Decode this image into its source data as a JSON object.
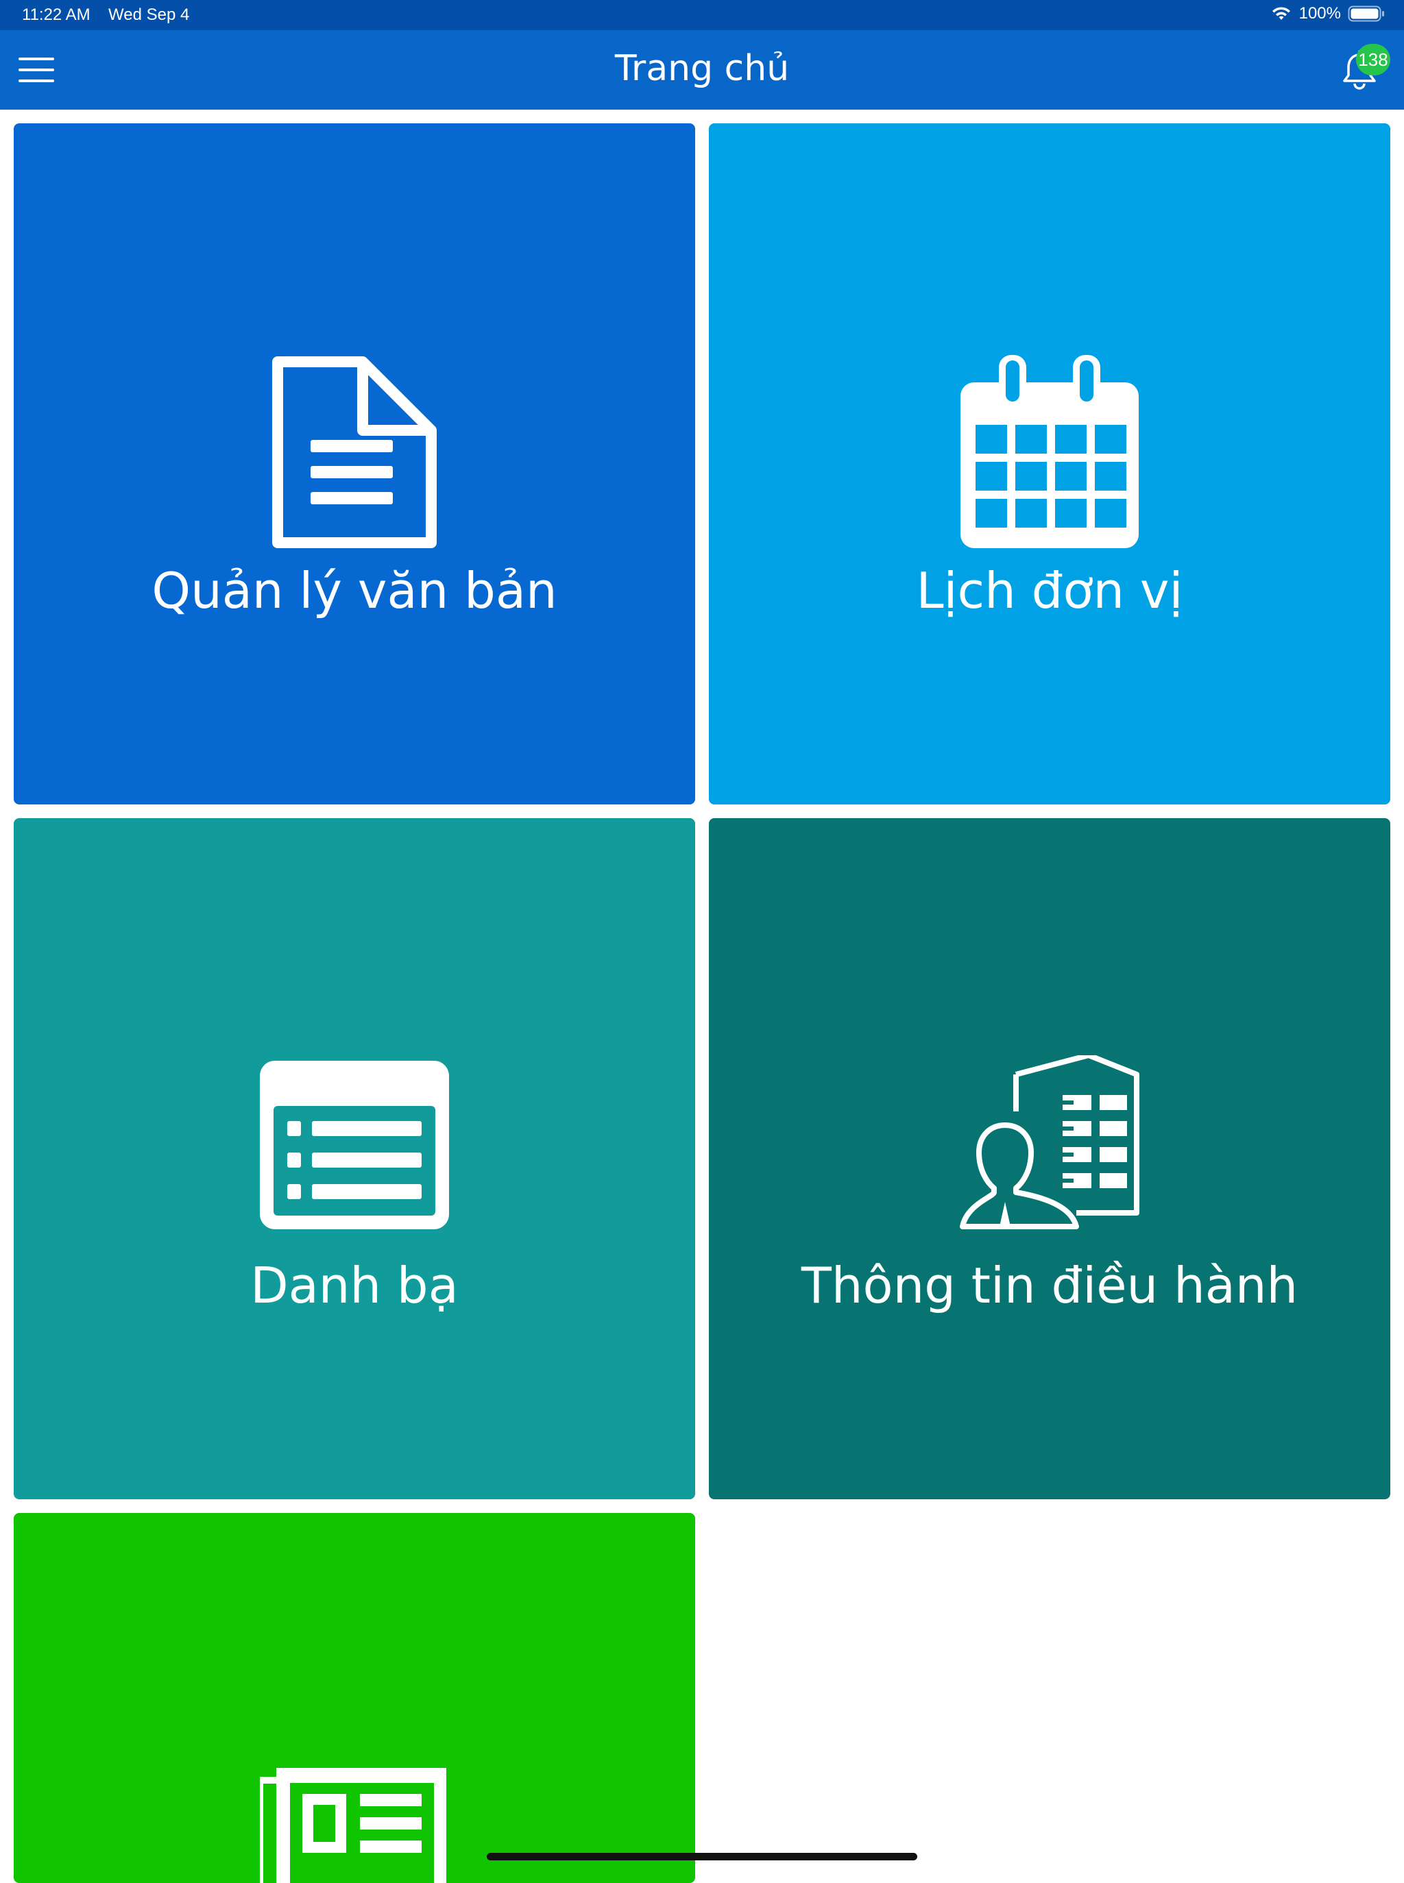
{
  "status_bar": {
    "time": "11:22 AM",
    "date": "Wed Sep 4",
    "battery": "100%"
  },
  "header": {
    "title": "Trang chủ",
    "notification_count": "138"
  },
  "tiles": [
    {
      "label": "Quản lý văn bản",
      "icon": "document-icon",
      "color": "#0668d0"
    },
    {
      "label": "Lịch đơn vị",
      "icon": "calendar-icon",
      "color": "#00a2e5"
    },
    {
      "label": "Danh bạ",
      "icon": "contacts-list-icon",
      "color": "#119b9a"
    },
    {
      "label": "Thông tin điều hành",
      "icon": "office-person-icon",
      "color": "#087471"
    },
    {
      "label": "",
      "icon": "newspaper-icon",
      "color": "#10c500"
    }
  ],
  "colors": {
    "status_bar": "#0450a8",
    "nav_bar": "#0866c9",
    "badge": "#27c44b"
  }
}
